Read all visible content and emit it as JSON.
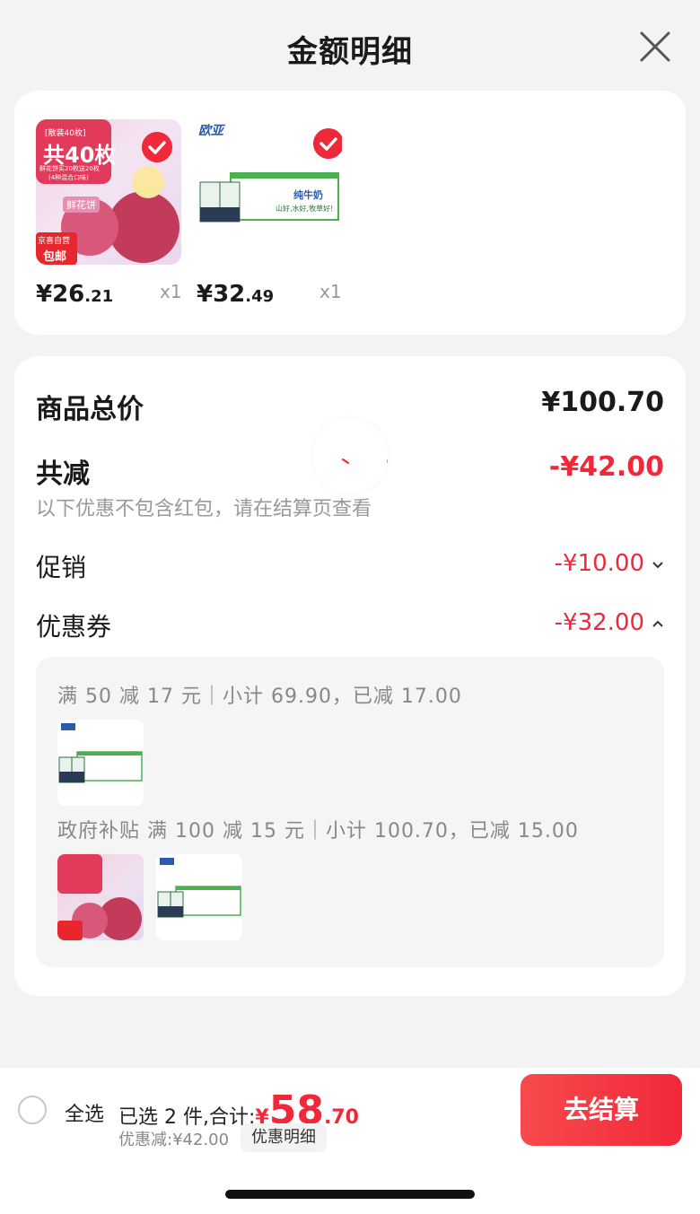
{
  "header": {
    "title": "金额明细"
  },
  "products": [
    {
      "price_int": "¥26",
      "price_dec": ".21",
      "qty": "x1",
      "tag_top": "[散装40枚]",
      "tag_count": "共40枚",
      "tag_note": "鲜花饼买20枚送20枚",
      "tag_sub": "(4种混合口味)",
      "badge_line1": "京喜自营",
      "badge_line2": "包邮",
      "label": "鲜花饼"
    },
    {
      "price_int": "¥32",
      "price_dec": ".49",
      "qty": "x1",
      "brand": "欧亚",
      "label": "纯牛奶",
      "slogan": "山好,水好,牧草好!"
    }
  ],
  "summary": {
    "total_label": "商品总价",
    "total_value": "¥100.70",
    "reduce_label": "共减",
    "reduce_value": "-¥42.00",
    "note": "以下优惠不包含红包，请在结算页查看",
    "promo_label": "促销",
    "promo_value": "-¥10.00",
    "coupon_label": "优惠券",
    "coupon_value": "-¥32.00"
  },
  "coupons": [
    {
      "text": "满 50 减 17 元｜小计 69.90，已减 17.00"
    },
    {
      "text": "政府补贴 满 100 减 15 元｜小计 100.70，已减 15.00"
    }
  ],
  "footer": {
    "select_all": "全选",
    "selected_text": "已选 2 件,合计:",
    "total_yen": "¥",
    "total_int": "58",
    "total_dec": ".70",
    "saved": "优惠减:¥42.00",
    "detail_button": "优惠明细",
    "checkout_button": "去结算"
  },
  "colors": {
    "accent": "#f0293a",
    "milk_green": "#4caf50",
    "background": "#f3f3f3"
  }
}
